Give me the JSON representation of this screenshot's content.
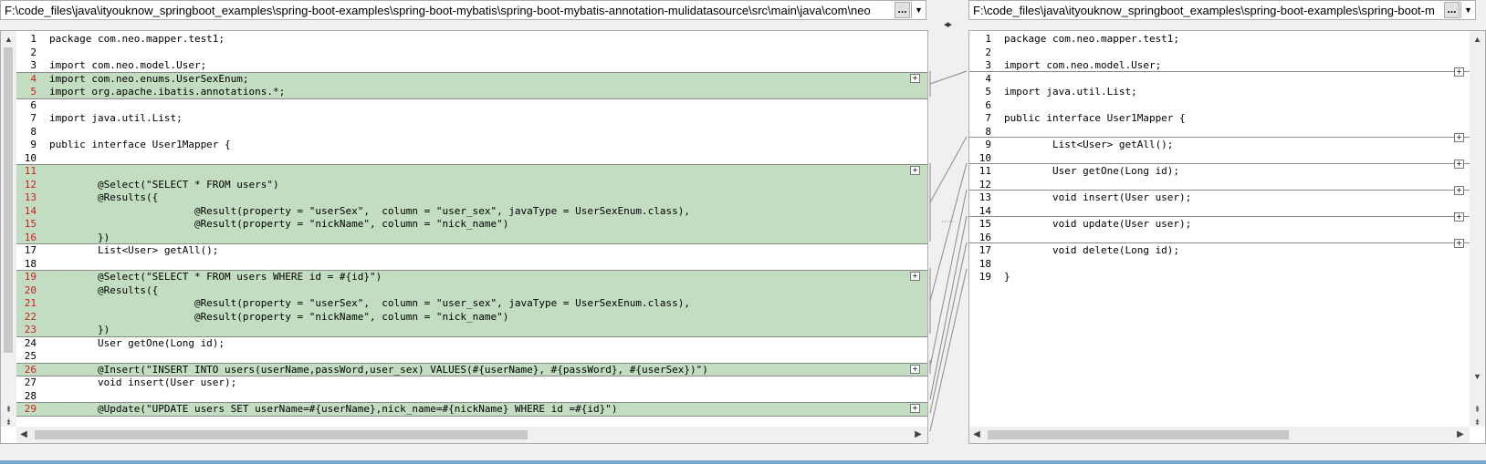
{
  "left": {
    "path": "F:\\code_files\\java\\ityouknow_springboot_examples\\spring-boot-examples\\spring-boot-mybatis\\spring-boot-mybatis-annotation-mulidatasource\\src\\main\\java\\com\\neo",
    "browse_label": "...",
    "lines": [
      {
        "n": "1",
        "t": "package com.neo.mapper.test1;",
        "diff": false
      },
      {
        "n": "2",
        "t": "",
        "diff": false
      },
      {
        "n": "3",
        "t": "import com.neo.model.User;",
        "diff": false
      },
      {
        "n": "4",
        "t": "import com.neo.enums.UserSexEnum;",
        "diff": true
      },
      {
        "n": "5",
        "t": "import org.apache.ibatis.annotations.*;",
        "diff": true
      },
      {
        "n": "6",
        "t": "",
        "diff": false
      },
      {
        "n": "7",
        "t": "import java.util.List;",
        "diff": false
      },
      {
        "n": "8",
        "t": "",
        "diff": false
      },
      {
        "n": "9",
        "t": "public interface User1Mapper {",
        "diff": false
      },
      {
        "n": "10",
        "t": "",
        "diff": false
      },
      {
        "n": "11",
        "t": "",
        "diff": true
      },
      {
        "n": "12",
        "t": "\t@Select(\"SELECT * FROM users\")",
        "diff": true
      },
      {
        "n": "13",
        "t": "\t@Results({",
        "diff": true
      },
      {
        "n": "14",
        "t": "\t\t\t@Result(property = \"userSex\",  column = \"user_sex\", javaType = UserSexEnum.class),",
        "diff": true
      },
      {
        "n": "15",
        "t": "\t\t\t@Result(property = \"nickName\", column = \"nick_name\")",
        "diff": true
      },
      {
        "n": "16",
        "t": "\t})",
        "diff": true
      },
      {
        "n": "17",
        "t": "\tList<User> getAll();",
        "diff": false
      },
      {
        "n": "18",
        "t": "",
        "diff": false
      },
      {
        "n": "19",
        "t": "\t@Select(\"SELECT * FROM users WHERE id = #{id}\")",
        "diff": true
      },
      {
        "n": "20",
        "t": "\t@Results({",
        "diff": true
      },
      {
        "n": "21",
        "t": "\t\t\t@Result(property = \"userSex\",  column = \"user_sex\", javaType = UserSexEnum.class),",
        "diff": true
      },
      {
        "n": "22",
        "t": "\t\t\t@Result(property = \"nickName\", column = \"nick_name\")",
        "diff": true
      },
      {
        "n": "23",
        "t": "\t})",
        "diff": true
      },
      {
        "n": "24",
        "t": "\tUser getOne(Long id);",
        "diff": false
      },
      {
        "n": "25",
        "t": "",
        "diff": false
      },
      {
        "n": "26",
        "t": "\t@Insert(\"INSERT INTO users(userName,passWord,user_sex) VALUES(#{userName}, #{passWord}, #{userSex})\")",
        "diff": true
      },
      {
        "n": "27",
        "t": "\tvoid insert(User user);",
        "diff": false
      },
      {
        "n": "28",
        "t": "",
        "diff": false
      },
      {
        "n": "29",
        "t": "\t@Update(\"UPDATE users SET userName=#{userName},nick_name=#{nickName} WHERE id =#{id}\")",
        "diff": true
      }
    ]
  },
  "right": {
    "path": "F:\\code_files\\java\\ityouknow_springboot_examples\\spring-boot-examples\\spring-boot-m",
    "browse_label": "...",
    "lines": [
      {
        "n": "1",
        "t": "package com.neo.mapper.test1;"
      },
      {
        "n": "2",
        "t": ""
      },
      {
        "n": "3",
        "t": "import com.neo.model.User;"
      },
      {
        "n": "4",
        "t": ""
      },
      {
        "n": "5",
        "t": "import java.util.List;"
      },
      {
        "n": "6",
        "t": ""
      },
      {
        "n": "7",
        "t": "public interface User1Mapper {"
      },
      {
        "n": "8",
        "t": ""
      },
      {
        "n": "9",
        "t": "\tList<User> getAll();"
      },
      {
        "n": "10",
        "t": ""
      },
      {
        "n": "11",
        "t": "\tUser getOne(Long id);"
      },
      {
        "n": "12",
        "t": ""
      },
      {
        "n": "13",
        "t": "\tvoid insert(User user);"
      },
      {
        "n": "14",
        "t": ""
      },
      {
        "n": "15",
        "t": "\tvoid update(User user);"
      },
      {
        "n": "16",
        "t": ""
      },
      {
        "n": "17",
        "t": "\tvoid delete(Long id);"
      },
      {
        "n": "18",
        "t": ""
      },
      {
        "n": "19",
        "t": "}"
      }
    ]
  },
  "merge_button_label": "+",
  "colors": {
    "diff_bg": "#c2ddc2",
    "diff_num": "#cc2222",
    "keyword": "#000080"
  }
}
